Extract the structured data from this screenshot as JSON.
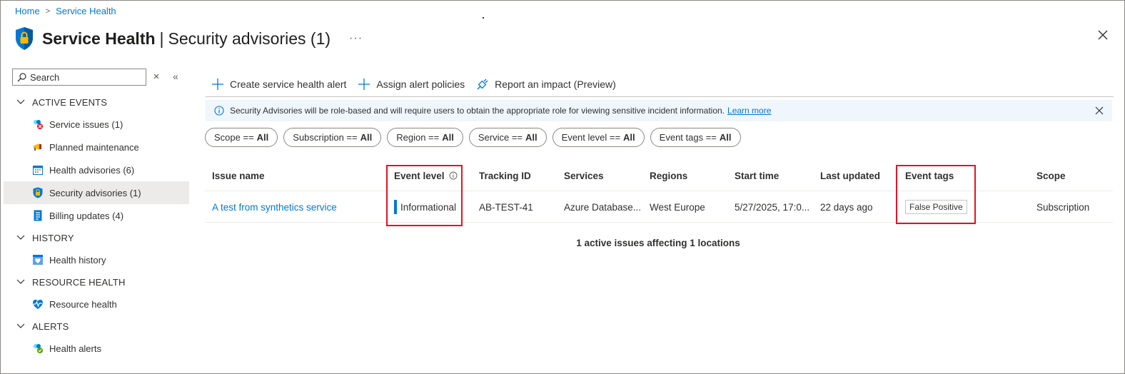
{
  "breadcrumb": {
    "home": "Home",
    "current": "Service Health"
  },
  "header": {
    "title": "Service Health",
    "separator": "|",
    "subtitle": "Security advisories (1)",
    "more": "···"
  },
  "sidebar": {
    "search_placeholder": "Search",
    "groups": [
      {
        "label": "ACTIVE EVENTS"
      },
      {
        "label": "HISTORY"
      },
      {
        "label": "RESOURCE HEALTH"
      },
      {
        "label": "ALERTS"
      }
    ],
    "items": {
      "service_issues": "Service issues (1)",
      "planned_maintenance": "Planned maintenance",
      "health_advisories": "Health advisories (6)",
      "security_advisories": "Security advisories (1)",
      "billing_updates": "Billing updates (4)",
      "health_history": "Health history",
      "resource_health": "Resource health",
      "health_alerts": "Health alerts"
    }
  },
  "toolbar": {
    "create_alert": "Create service health alert",
    "assign_policies": "Assign alert policies",
    "report_impact": "Report an impact (Preview)"
  },
  "info": {
    "message": "Security Advisories will be role-based and will require users to obtain the appropriate role for viewing sensitive incident information.",
    "link": "Learn more"
  },
  "filters": [
    {
      "label": "Scope ==",
      "value": "All"
    },
    {
      "label": "Subscription ==",
      "value": "All"
    },
    {
      "label": "Region ==",
      "value": "All"
    },
    {
      "label": "Service ==",
      "value": "All"
    },
    {
      "label": "Event level ==",
      "value": "All"
    },
    {
      "label": "Event tags ==",
      "value": "All"
    }
  ],
  "table": {
    "headers": {
      "issue_name": "Issue name",
      "event_level": "Event level",
      "tracking_id": "Tracking ID",
      "services": "Services",
      "regions": "Regions",
      "start_time": "Start time",
      "last_updated": "Last updated",
      "event_tags": "Event tags",
      "scope": "Scope"
    },
    "rows": [
      {
        "issue_name": "A test from synthetics service",
        "event_level": "Informational",
        "tracking_id": "AB-TEST-41",
        "services": "Azure Database...",
        "regions": "West Europe",
        "start_time": "5/27/2025, 17:0...",
        "last_updated": "22 days ago",
        "event_tag": "False Positive",
        "scope": "Subscription"
      }
    ]
  },
  "summary": "1 active issues affecting 1 locations",
  "colors": {
    "accent": "#0078d4",
    "highlight": "#e81123",
    "info_bg": "#eff6fc"
  }
}
